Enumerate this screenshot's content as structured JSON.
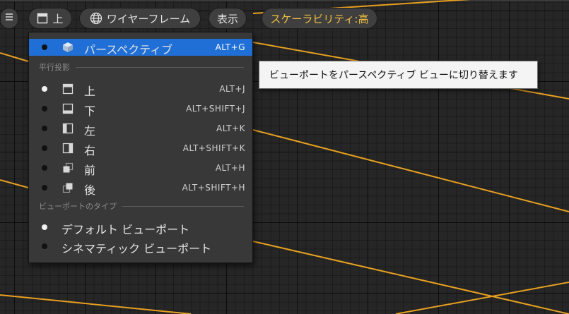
{
  "toolbar": {
    "view_label": "上",
    "render_mode_label": "ワイヤーフレーム",
    "show_label": "表示",
    "scalability_label": "スケーラビリティ:高"
  },
  "menu": {
    "perspective": {
      "label": "パースペクティブ",
      "shortcut": "ALT+G"
    },
    "ortho_section": "平行投影",
    "ortho_items": [
      {
        "label": "上",
        "shortcut": "ALT+J",
        "icon": "view-top-icon"
      },
      {
        "label": "下",
        "shortcut": "ALT+SHIFT+J",
        "icon": "view-bottom-icon"
      },
      {
        "label": "左",
        "shortcut": "ALT+K",
        "icon": "view-left-icon"
      },
      {
        "label": "右",
        "shortcut": "ALT+SHIFT+K",
        "icon": "view-right-icon"
      },
      {
        "label": "前",
        "shortcut": "ALT+H",
        "icon": "view-front-icon"
      },
      {
        "label": "後",
        "shortcut": "ALT+SHIFT+H",
        "icon": "view-back-icon"
      }
    ],
    "type_section": "ビューポートのタイプ",
    "type_items": [
      {
        "label": "デフォルト ビューポート",
        "active": true
      },
      {
        "label": "シネマティック ビューポート",
        "active": false
      }
    ]
  },
  "tooltip": {
    "text": "ビューポートをパースペクティブ ビューに切り替えます"
  },
  "colors": {
    "selection": "#1f6fd6",
    "wire": "#e8a020",
    "scalability": "#f0c040"
  }
}
